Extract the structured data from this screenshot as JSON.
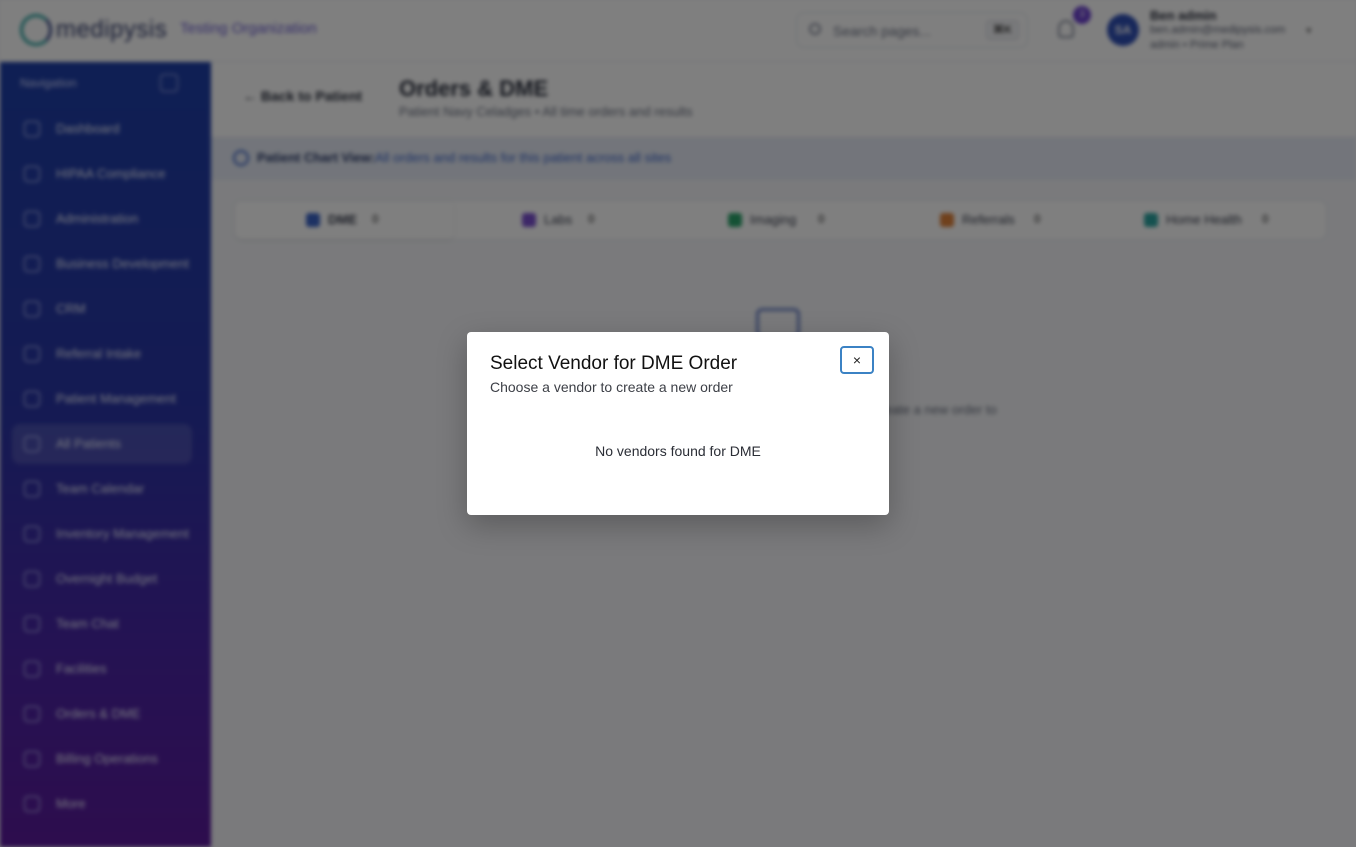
{
  "header": {
    "logo_text": "medipysis",
    "organization": "Testing Organization",
    "search_placeholder": "Search pages...",
    "search_shortcut": "⌘K",
    "notification_count": "3",
    "user_initials": "SA",
    "user_name": "Ben admin",
    "user_email": "ben.admin@medipysis.com",
    "user_role": "admin • Prime Plan"
  },
  "sidebar": {
    "title": "Navigation",
    "items": [
      {
        "label": "Dashboard"
      },
      {
        "label": "HIPAA Compliance"
      },
      {
        "label": "Administration"
      },
      {
        "label": "Business Development"
      },
      {
        "label": "CRM"
      },
      {
        "label": "Referral Intake"
      },
      {
        "label": "Patient Management"
      },
      {
        "label": "All Patients"
      },
      {
        "label": "Team Calendar"
      },
      {
        "label": "Inventory Management"
      },
      {
        "label": "Overnight Budget"
      },
      {
        "label": "Team Chat"
      },
      {
        "label": "Facilities"
      },
      {
        "label": "Orders & DME"
      },
      {
        "label": "Billing Operations"
      },
      {
        "label": "More"
      }
    ]
  },
  "page": {
    "back_label": "Back to Patient",
    "title": "Orders & DME",
    "subtitle": "Patient Navy Celadges • All time orders and results",
    "banner_bold": "Patient Chart View:",
    "banner_text": "All orders and results for this patient across all sites",
    "tabs": [
      {
        "label": "DME",
        "count": "0",
        "color": "#3a63c7"
      },
      {
        "label": "Labs",
        "count": "0",
        "color": "#7a4fd0"
      },
      {
        "label": "Imaging",
        "count": "0",
        "color": "#2aa36a"
      },
      {
        "label": "Referrals",
        "count": "0",
        "color": "#e0823a"
      },
      {
        "label": "Home Health",
        "count": "0",
        "color": "#2aa3a0"
      }
    ],
    "empty_text": "Create a new order to"
  },
  "modal": {
    "title": "Select Vendor for DME Order",
    "subtitle": "Choose a vendor to create a new order",
    "close_symbol": "×",
    "empty_message": "No vendors found for DME"
  }
}
